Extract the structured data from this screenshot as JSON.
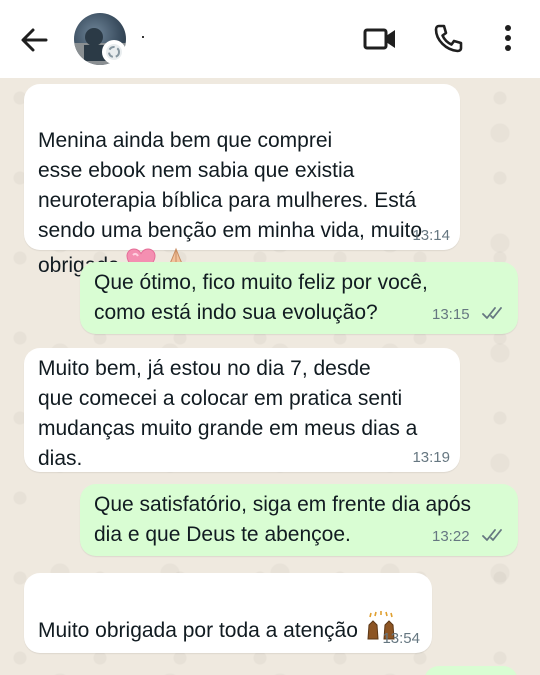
{
  "header": {
    "contact_name": "·",
    "icons": [
      "back-arrow-icon",
      "avatar-status-icon",
      "video-call-icon",
      "phone-icon",
      "more-vert-icon"
    ]
  },
  "messages": [
    {
      "direction": "incoming",
      "text": "Menina ainda bem que comprei\nesse ebook nem sabia que existia\nneuroterapia bíblica para mulheres. Está\nsendo uma benção em minha vida, muito\nobrigada",
      "emoji": [
        "pink-heart-emoji",
        "folded-hands-emoji"
      ],
      "time": "13:14"
    },
    {
      "direction": "outgoing",
      "text": "Que ótimo, fico muito feliz por você,\ncomo está indo sua evolução?",
      "time": "13:15",
      "read": true
    },
    {
      "direction": "incoming",
      "text": "Muito bem, já estou no dia 7, desde\nque comecei a colocar em pratica senti\nmudanças muito grande em meus dias a\ndias.",
      "time": "13:19"
    },
    {
      "direction": "outgoing",
      "text": "Que satisfatório, siga em frente dia após\ndia e que Deus te abençoe.",
      "time": "13:22",
      "read": true
    },
    {
      "direction": "incoming",
      "text": "Muito obrigada por toda a atenção",
      "emoji": [
        "raising-hands-emoji"
      ],
      "time": "13:54"
    }
  ],
  "colors": {
    "incoming_bubble": "#ffffff",
    "outgoing_bubble": "#d9fdd3",
    "chat_background": "#efe9df",
    "read_ticks": "#667781"
  }
}
